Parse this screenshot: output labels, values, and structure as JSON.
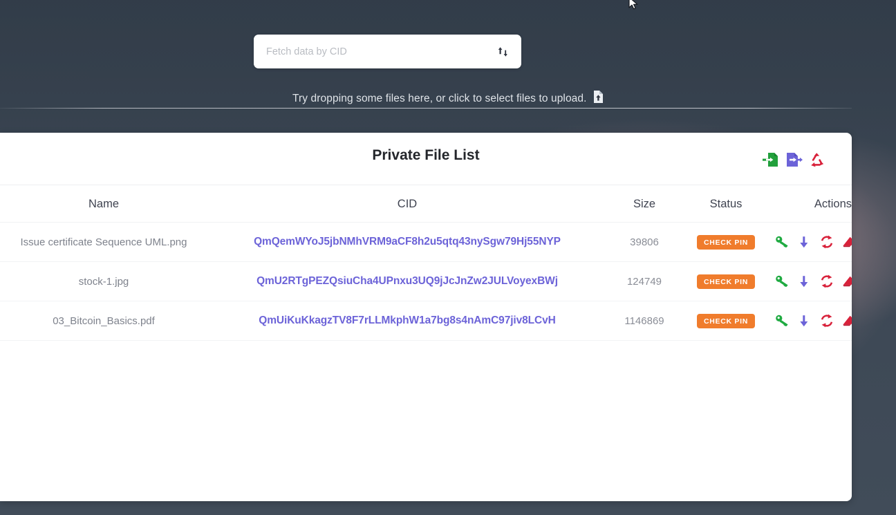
{
  "background": {
    "base_color": "#3b4655",
    "cloud_tint": "#d8aaaa"
  },
  "upload_zone": {
    "search": {
      "placeholder": "Fetch data by CID",
      "value": "",
      "sort_icon": "sort-arrows-icon"
    },
    "drop_hint_text": "Try dropping some files here, or click to select files to upload.",
    "drop_hint_icon": "file-upload-icon"
  },
  "card": {
    "title": "Private File List",
    "header_actions": [
      {
        "name": "import-file-button",
        "icon": "file-import-icon",
        "color": "#22a03c"
      },
      {
        "name": "export-file-button",
        "icon": "file-export-icon",
        "color": "#6c63d8"
      },
      {
        "name": "recycle-button",
        "icon": "recycle-icon",
        "color": "#d8213a"
      }
    ],
    "table": {
      "columns": [
        "Name",
        "CID",
        "Size",
        "Status",
        "Actions"
      ],
      "rows": [
        {
          "name": "Issue certificate Sequence UML.png",
          "cid": "QmQemWYoJ5jbNMhVRM9aCF8h2u5qtq43nySgw79Hj55NYP",
          "size": "39806",
          "status": "CHECK PIN"
        },
        {
          "name": "stock-1.jpg",
          "cid": "QmU2RTgPEZQsiuCha4UPnxu3UQ9jJcJnZw2JULVoyexBWj",
          "size": "124749",
          "status": "CHECK PIN"
        },
        {
          "name": "03_Bitcoin_Basics.pdf",
          "cid": "QmUiKuKkagzTV8F7rLLMkphW1a7bg8s4nAmC97jiv8LCvH",
          "size": "1146869",
          "status": "CHECK PIN"
        }
      ],
      "row_actions": [
        {
          "name": "decrypt-key-button",
          "icon": "key-icon",
          "color": "#1faa41"
        },
        {
          "name": "download-button",
          "icon": "download-arrow-icon",
          "color": "#6c63d8"
        },
        {
          "name": "sync-button",
          "icon": "sync-refresh-icon",
          "color": "#d8213a"
        },
        {
          "name": "erase-button",
          "icon": "eraser-icon",
          "color": "#d8213a"
        }
      ]
    }
  },
  "colors": {
    "cid_link": "#6c63d8",
    "status_badge": "#f07c2c",
    "card_background": "#ffffff"
  }
}
